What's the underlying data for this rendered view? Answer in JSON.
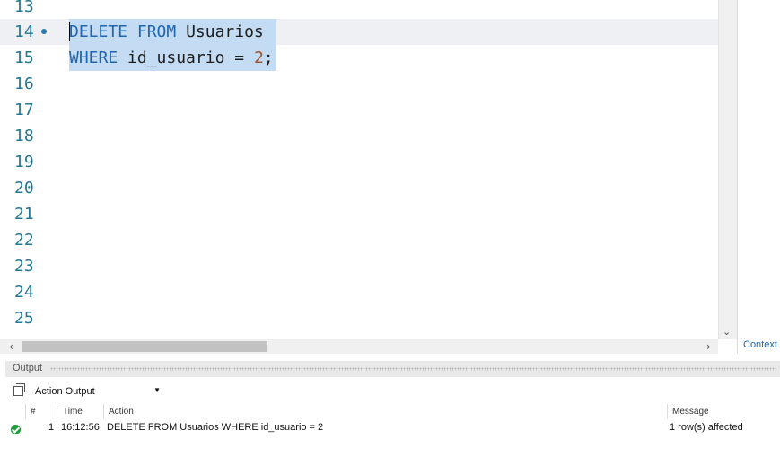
{
  "editor": {
    "lines": [
      {
        "n": "13"
      },
      {
        "n": "14"
      },
      {
        "n": "15"
      },
      {
        "n": "16"
      },
      {
        "n": "17"
      },
      {
        "n": "18"
      },
      {
        "n": "19"
      },
      {
        "n": "20"
      },
      {
        "n": "21"
      },
      {
        "n": "22"
      },
      {
        "n": "23"
      },
      {
        "n": "24"
      },
      {
        "n": "25"
      }
    ],
    "stmt1": {
      "kw1": "DELETE",
      "kw2": "FROM",
      "ident": "Usuarios"
    },
    "stmt2": {
      "kw": "WHERE",
      "ident": "id_usuario",
      "op": "=",
      "num": "2",
      "end": ";"
    }
  },
  "context_tab": "Context",
  "output": {
    "title": "Output",
    "selector": "Action Output",
    "columns": {
      "num": "#",
      "time": "Time",
      "action": "Action",
      "message": "Message"
    },
    "rows": [
      {
        "num": "1",
        "time": "16:12:56",
        "action": "DELETE FROM Usuarios WHERE id_usuario = 2",
        "message": "1 row(s) affected",
        "status": "success"
      }
    ]
  },
  "colors": {
    "keyword": "#1f66b0",
    "number": "#a0522d",
    "line_number": "#237893",
    "selection": "#c3dcf3",
    "success": "#1f9e3a"
  }
}
